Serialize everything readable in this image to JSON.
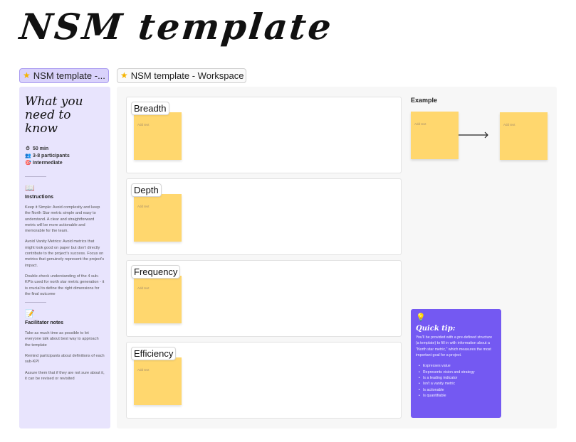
{
  "board": {
    "title": "NSM template"
  },
  "frames": [
    {
      "label": "NSM template -...",
      "icon": "star-icon",
      "icon_glyph": "★",
      "selected": true
    },
    {
      "label": "NSM template - Workspace",
      "icon": "star-icon",
      "icon_glyph": "★",
      "selected": false
    }
  ],
  "sidebar": {
    "heading": "What you need to know",
    "meta": [
      {
        "icon": "stopwatch-icon",
        "glyph": "⏱",
        "text": "50 min"
      },
      {
        "icon": "people-icon",
        "glyph": "👥",
        "text": "3-8 participants"
      },
      {
        "icon": "target-icon",
        "glyph": "🎯",
        "text": "Intermediate"
      }
    ],
    "instructions": {
      "icon_glyph": "📖",
      "title": "Instructions",
      "paragraphs": [
        "Keep it Simple: Avoid complexity and keep the North Star metric simple and easy to understand. A clear and straightforward metric will be more actionable and memorable for the team.",
        "Avoid Vanity Metrics: Avoid metrics that might look good on paper but don't directly contribute to the project's success. Focus on metrics that genuinely represent the project's impact.",
        "Double-check understanding of the 4 sub-KPIs used for north star metric generation - it is crucial to define the right dimensions for the final outcome"
      ]
    },
    "facilitator": {
      "icon_glyph": "📝",
      "title": "Facilitator notes",
      "paragraphs": [
        "Take as much time as possible to let everyone talk  about best way to approach the template",
        "Remind participants about definitions of each sub-KPI",
        "Assure them that if they are not sure about it, it can be revised or revisited"
      ]
    }
  },
  "workspace": {
    "rows": [
      {
        "label": "Breadth",
        "sticky_placeholder": "Add text"
      },
      {
        "label": "Depth",
        "sticky_placeholder": "Add text"
      },
      {
        "label": "Frequency",
        "sticky_placeholder": "Add text"
      },
      {
        "label": "Efficiency",
        "sticky_placeholder": "Add text"
      }
    ],
    "example": {
      "title": "Example",
      "sticky_1_placeholder": "Add text",
      "sticky_2_placeholder": "Add text"
    },
    "tip": {
      "icon_glyph": "💡",
      "title": "Quick tip:",
      "body": "You'll be provided with a pre-defined structure (a template) to fill in with information about a \"North star metric,\" which measures the most important goal for a project.",
      "bullets": [
        "Expresses value",
        "Represents vision and strategy",
        "Is a leading indicator",
        "Isn't a vanity metric",
        "Is actionable",
        "Is quantifiable"
      ]
    }
  },
  "colors": {
    "sticky": "#ffd76e",
    "sidebar_bg": "#e8e4fd",
    "tip_bg": "#7459f2",
    "selected_frame_tab": "#d9d2fb"
  }
}
